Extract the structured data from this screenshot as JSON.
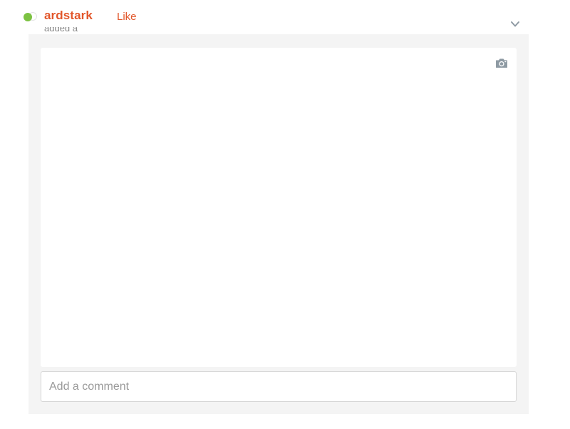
{
  "post": {
    "username": "ardstark",
    "like_label": "Like",
    "clipped_caption": "added a",
    "status_color": "#7cc242"
  },
  "icons": {
    "status": "online-status-dot",
    "menu": "chevron-down-icon",
    "photo": "camera-icon"
  },
  "comment": {
    "placeholder": "Add a comment",
    "value": ""
  },
  "colors": {
    "accent": "#e2562a",
    "icon_gray": "#8e9aa3",
    "panel_bg": "#f4f4f4"
  }
}
